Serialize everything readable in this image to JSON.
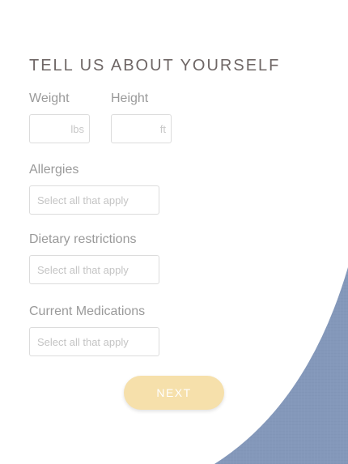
{
  "form": {
    "title": "TELL US ABOUT YOURSELF",
    "weight": {
      "label": "Weight",
      "unit": "lbs",
      "value": ""
    },
    "height": {
      "label": "Height",
      "unit": "ft",
      "value": ""
    },
    "allergies": {
      "label": "Allergies",
      "placeholder": "Select all that apply"
    },
    "dietary": {
      "label": "Dietary restrictions",
      "placeholder": "Select all that apply"
    },
    "medications": {
      "label": "Current Medications",
      "placeholder": "Select all that apply"
    },
    "next_label": "NEXT"
  },
  "colors": {
    "accent_button": "#f6e0ab",
    "decor_blue": "#8498ba",
    "title_text": "#6f6766"
  }
}
